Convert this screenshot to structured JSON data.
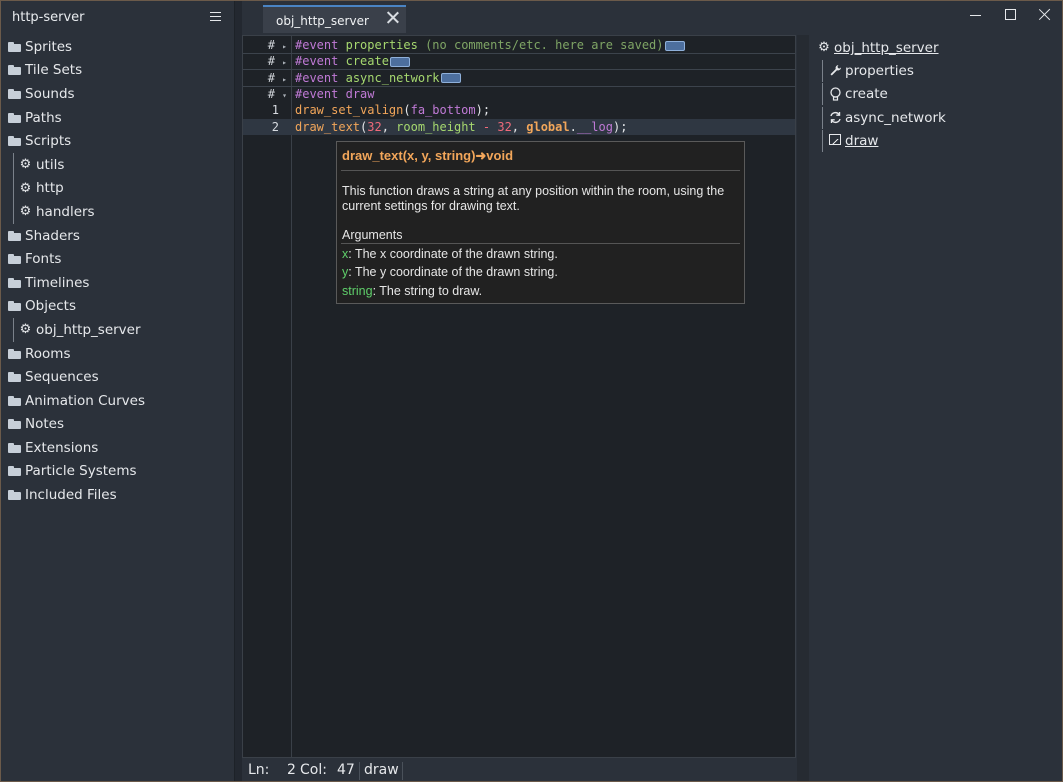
{
  "sidebar": {
    "project_title": "http-server",
    "items": [
      {
        "label": "Sprites",
        "type": "folder"
      },
      {
        "label": "Tile Sets",
        "type": "folder"
      },
      {
        "label": "Sounds",
        "type": "folder"
      },
      {
        "label": "Paths",
        "type": "folder"
      },
      {
        "label": "Scripts",
        "type": "folder"
      },
      {
        "label": "utils",
        "type": "script"
      },
      {
        "label": "http",
        "type": "script"
      },
      {
        "label": "handlers",
        "type": "script"
      },
      {
        "label": "Shaders",
        "type": "folder"
      },
      {
        "label": "Fonts",
        "type": "folder"
      },
      {
        "label": "Timelines",
        "type": "folder"
      },
      {
        "label": "Objects",
        "type": "folder"
      },
      {
        "label": "obj_http_server",
        "type": "object"
      },
      {
        "label": "Rooms",
        "type": "folder"
      },
      {
        "label": "Sequences",
        "type": "folder"
      },
      {
        "label": "Animation Curves",
        "type": "folder"
      },
      {
        "label": "Notes",
        "type": "folder"
      },
      {
        "label": "Extensions",
        "type": "folder"
      },
      {
        "label": "Particle Systems",
        "type": "folder"
      },
      {
        "label": "Included Files",
        "type": "folder"
      }
    ]
  },
  "tabs": [
    {
      "label": "obj_http_server",
      "active": true
    }
  ],
  "editor": {
    "event_rows": [
      {
        "gutter": "#",
        "keyword": "#event",
        "name": "properties",
        "comment": "(no comments/etc. here are saved)",
        "collapsed": true
      },
      {
        "gutter": "#",
        "keyword": "#event",
        "name": "create",
        "comment": "",
        "collapsed": true
      },
      {
        "gutter": "#",
        "keyword": "#event",
        "name": "async_network",
        "comment": "",
        "collapsed": true
      },
      {
        "gutter": "#",
        "keyword": "#event",
        "name": "draw",
        "comment": "",
        "collapsed": false
      }
    ],
    "code_lines": [
      {
        "line": "1",
        "tokens": [
          [
            "fn",
            "draw_set_valign"
          ],
          [
            "punc",
            "("
          ],
          [
            "const",
            "fa_bottom"
          ],
          [
            "punc",
            ");"
          ]
        ]
      },
      {
        "line": "2",
        "tokens": [
          [
            "fn",
            "draw_text"
          ],
          [
            "punc",
            "("
          ],
          [
            "num",
            "32"
          ],
          [
            "punc",
            ", "
          ],
          [
            "var",
            "room_height"
          ],
          [
            "op",
            " - "
          ],
          [
            "num",
            "32"
          ],
          [
            "punc",
            ", "
          ],
          [
            "glob",
            "global"
          ],
          [
            "punc",
            "."
          ],
          [
            "field",
            "__log"
          ],
          [
            "punc",
            ");"
          ]
        ]
      }
    ]
  },
  "tooltip": {
    "signature": "draw_text(x, y, string)➜void",
    "description": "This function draws a string at any position within the room, using the current settings for drawing text.",
    "args_heading": "Arguments",
    "args": [
      {
        "name": "x",
        "text": ": The x coordinate of the drawn string."
      },
      {
        "name": "y",
        "text": ": The y coordinate of the drawn string."
      },
      {
        "name": "string",
        "text": ": The string to draw."
      }
    ]
  },
  "status": {
    "ln_label": "Ln:",
    "ln": "2",
    "col_label": "Col:",
    "col": "47",
    "event": "draw"
  },
  "outline": {
    "root": "obj_http_server",
    "events": [
      {
        "label": "properties",
        "icon": "wrench-icon",
        "underline": false
      },
      {
        "label": "create",
        "icon": "lightbulb-icon",
        "underline": false
      },
      {
        "label": "async_network",
        "icon": "sync-icon",
        "underline": false
      },
      {
        "label": "draw",
        "icon": "image-icon",
        "underline": true
      }
    ]
  },
  "colors": {
    "accent": "#4a84c4",
    "function": "#f2a65a",
    "keyword": "#c07ad6",
    "number": "#f06a7a",
    "comment": "#7fa565",
    "argument": "#5fcf6a"
  }
}
